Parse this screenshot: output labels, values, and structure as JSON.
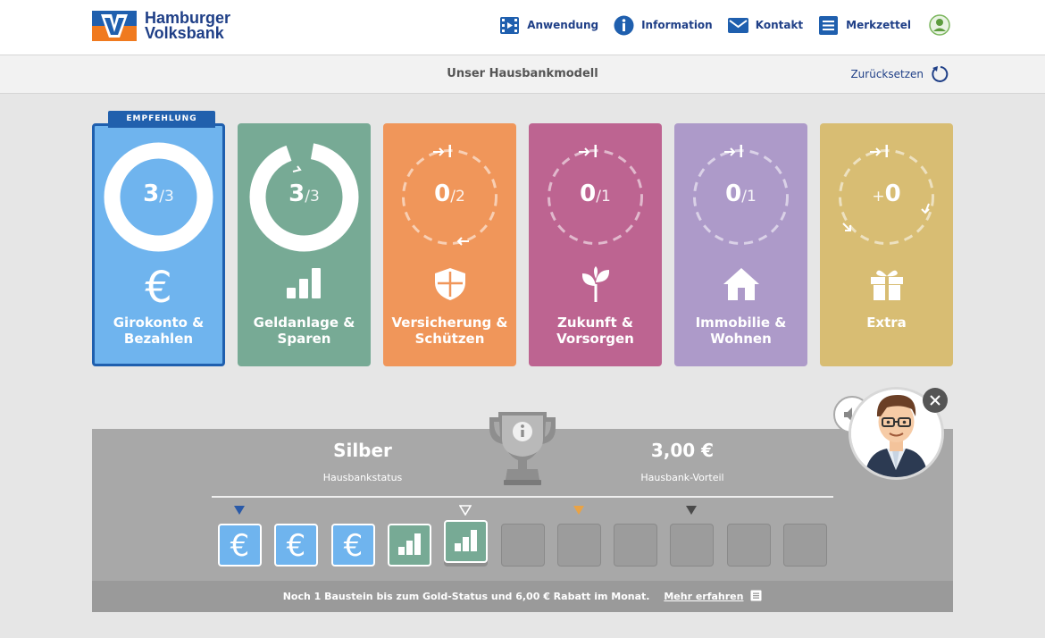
{
  "header": {
    "logo_line1": "Hamburger",
    "logo_line2": "Volksbank",
    "nav": [
      {
        "label": "Anwendung",
        "icon": "film-icon"
      },
      {
        "label": "Information",
        "icon": "info-icon"
      },
      {
        "label": "Kontakt",
        "icon": "envelope-icon"
      },
      {
        "label": "Merkzettel",
        "icon": "list-icon"
      }
    ],
    "brand_color": "#1f3f87"
  },
  "subheader": {
    "title": "Unser Hausbankmodell",
    "reset_label": "Zurücksetzen"
  },
  "cards": [
    {
      "name_line1": "Girokonto &",
      "name_line2": "Bezahlen",
      "count": "3",
      "max": "/3",
      "color": "#6fb4ee",
      "icon": "euro-icon",
      "badge": "EMPFEHLUNG",
      "progress": 1.0
    },
    {
      "name_line1": "Geldanlage &",
      "name_line2": "Sparen",
      "count": "3",
      "max": "/3",
      "color": "#77aa95",
      "icon": "bar-chart-icon",
      "progress": 1.0
    },
    {
      "name_line1": "Versicherung &",
      "name_line2": "Schützen",
      "count": "0",
      "max": "/2",
      "color": "#f0965a",
      "icon": "shield-icon",
      "progress": 0
    },
    {
      "name_line1": "Zukunft &",
      "name_line2": "Vorsorgen",
      "count": "0",
      "max": "/1",
      "color": "#bd6491",
      "icon": "plant-icon",
      "progress": 0
    },
    {
      "name_line1": "Immobilie &",
      "name_line2": "Wohnen",
      "count": "0",
      "max": "/1",
      "color": "#ad9ac9",
      "icon": "house-icon",
      "progress": 0
    },
    {
      "name_line1": "",
      "name_line2": "Extra",
      "count": "0",
      "prefix": "+",
      "max": "",
      "color": "#d8bd73",
      "icon": "gift-icon",
      "progress": 0
    }
  ],
  "status": {
    "level": "Silber",
    "level_label": "Hausbankstatus",
    "advantage": "3,00 €",
    "advantage_label": "Hausbank-Vorteil",
    "note": "Noch 1 Baustein bis zum Gold-Status und 6,00 € Rabatt im Monat.",
    "more_label": "Mehr erfahren"
  },
  "tiles": [
    "euro",
    "euro",
    "euro",
    "bars",
    "bars",
    "empty",
    "empty",
    "empty",
    "empty",
    "empty",
    "empty"
  ],
  "markers": [
    {
      "tile": 0,
      "color": "#2a5aa8",
      "filled": true
    },
    {
      "tile": 4,
      "color": "#ffffff",
      "filled": false
    },
    {
      "tile": 6,
      "color": "#e9a346",
      "filled": true
    },
    {
      "tile": 8,
      "color": "#4a4a4a",
      "filled": true
    }
  ]
}
